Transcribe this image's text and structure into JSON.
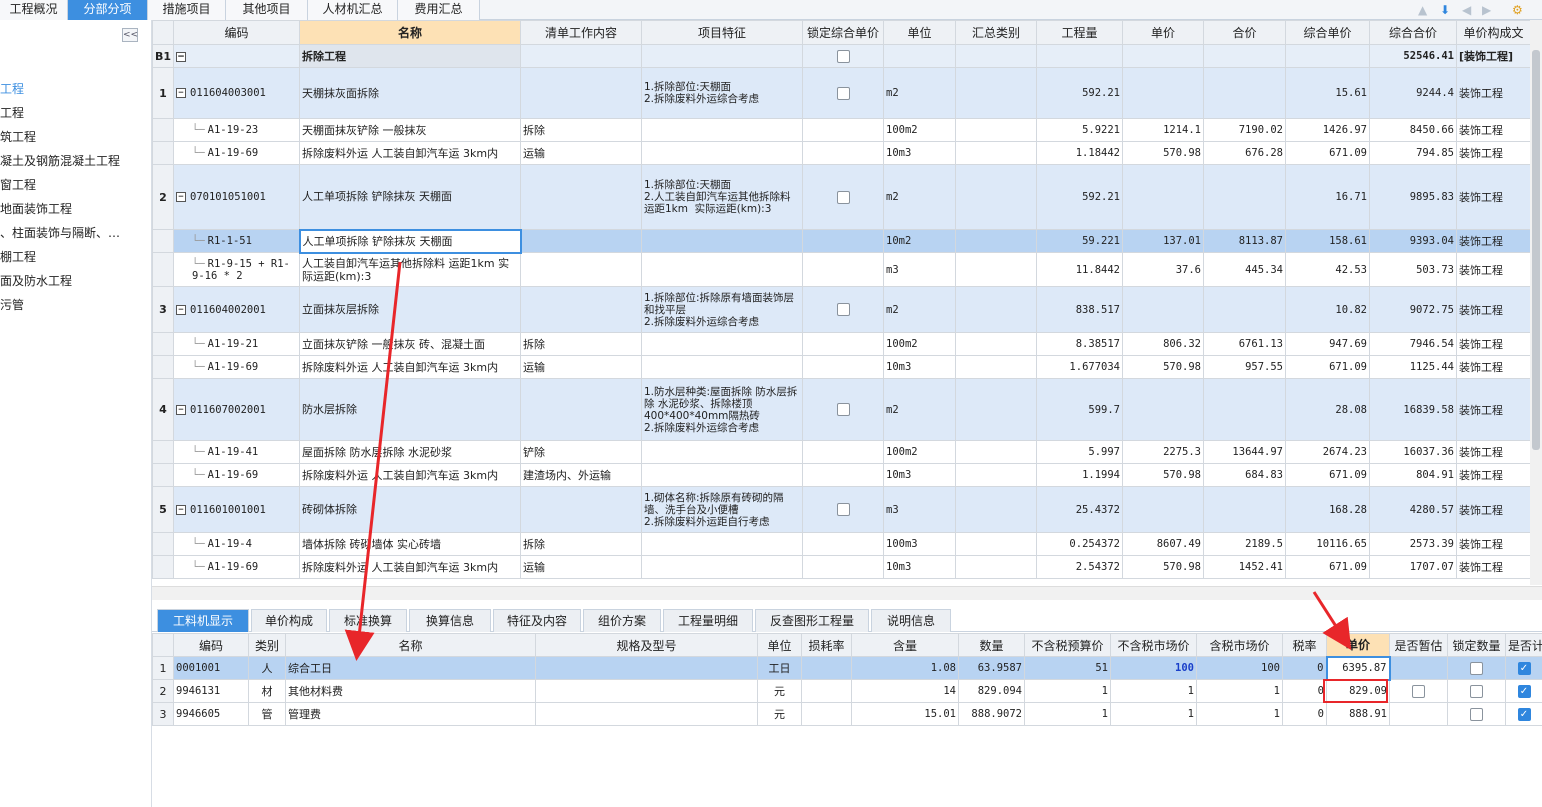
{
  "top_tabs": [
    "工程概况",
    "分部分项",
    "措施项目",
    "其他项目",
    "人材机汇总",
    "费用汇总"
  ],
  "sidebar": {
    "collapse": "<<",
    "items": [
      "工程",
      "工程",
      "筑工程",
      "凝土及钢筋混凝土工程",
      "窗工程",
      "地面装饰工程",
      "、柱面装饰与隔断、…",
      "棚工程",
      "面及防水工程",
      "污管"
    ]
  },
  "main_headers": [
    "编码",
    "名称",
    "清单工作内容",
    "项目特征",
    "锁定综合单价",
    "单位",
    "汇总类别",
    "工程量",
    "单价",
    "合价",
    "综合单价",
    "综合合价",
    "单价构成文"
  ],
  "section": {
    "num": "B1",
    "code": "",
    "name": "拆除工程",
    "total": "52546.41",
    "comp": "[装饰工程]"
  },
  "rows": [
    {
      "type": "list",
      "num": "1",
      "code": "011604003001",
      "name": "天棚抹灰面拆除",
      "work": "",
      "feat": "1.拆除部位:天棚面\n2.拆除废料外运综合考虑",
      "unit": "m2",
      "qty": "592.21",
      "price": "",
      "total": "",
      "uprice": "15.61",
      "utotal": "9244.4",
      "comp": "装饰工程"
    },
    {
      "type": "sub",
      "num": "",
      "code": "A1-19-23",
      "name": "天棚面抹灰铲除 一般抹灰",
      "work": "拆除",
      "feat": "",
      "unit": "100m2",
      "qty": "5.9221",
      "price": "1214.1",
      "total": "7190.02",
      "uprice": "1426.97",
      "utotal": "8450.66",
      "comp": "装饰工程"
    },
    {
      "type": "sub",
      "num": "",
      "code": "A1-19-69",
      "name": "拆除废料外运 人工装自卸汽车运 3km内",
      "work": "运输",
      "feat": "",
      "unit": "10m3",
      "qty": "1.18442",
      "price": "570.98",
      "total": "676.28",
      "uprice": "671.09",
      "utotal": "794.85",
      "comp": "装饰工程"
    },
    {
      "type": "list",
      "num": "2",
      "code": "070101051001",
      "name": "人工单项拆除 铲除抹灰 天棚面",
      "work": "",
      "feat": "1.拆除部位:天棚面\n2.人工装自卸汽车运其他拆除料 运距1km  实际运距(km):3",
      "unit": "m2",
      "qty": "592.21",
      "price": "",
      "total": "",
      "uprice": "16.71",
      "utotal": "9895.83",
      "comp": "装饰工程"
    },
    {
      "type": "sel",
      "num": "",
      "code": "R1-1-51",
      "name": "人工单项拆除 铲除抹灰 天棚面",
      "work": "",
      "feat": "",
      "unit": "10m2",
      "qty": "59.221",
      "price": "137.01",
      "total": "8113.87",
      "uprice": "158.61",
      "utotal": "9393.04",
      "comp": "装饰工程"
    },
    {
      "type": "sub",
      "num": "",
      "code": "R1-9-15 + R1-9-16 * 2",
      "name": "人工装自卸汽车运其他拆除料 运距1km 实际运距(km):3",
      "work": "",
      "feat": "",
      "unit": "m3",
      "qty": "11.8442",
      "price": "37.6",
      "total": "445.34",
      "uprice": "42.53",
      "utotal": "503.73",
      "comp": "装饰工程"
    },
    {
      "type": "list",
      "num": "3",
      "code": "011604002001",
      "name": "立面抹灰层拆除",
      "work": "",
      "feat": "1.拆除部位:拆除原有墙面装饰层和找平层\n2.拆除废料外运综合考虑",
      "unit": "m2",
      "qty": "838.517",
      "price": "",
      "total": "",
      "uprice": "10.82",
      "utotal": "9072.75",
      "comp": "装饰工程"
    },
    {
      "type": "sub",
      "num": "",
      "code": "A1-19-21",
      "name": "立面抹灰铲除 一般抹灰 砖、混凝土面",
      "work": "拆除",
      "feat": "",
      "unit": "100m2",
      "qty": "8.38517",
      "price": "806.32",
      "total": "6761.13",
      "uprice": "947.69",
      "utotal": "7946.54",
      "comp": "装饰工程"
    },
    {
      "type": "sub",
      "num": "",
      "code": "A1-19-69",
      "name": "拆除废料外运 人工装自卸汽车运 3km内",
      "work": "运输",
      "feat": "",
      "unit": "10m3",
      "qty": "1.677034",
      "price": "570.98",
      "total": "957.55",
      "uprice": "671.09",
      "utotal": "1125.44",
      "comp": "装饰工程"
    },
    {
      "type": "list",
      "num": "4",
      "code": "011607002001",
      "name": "防水层拆除",
      "work": "",
      "feat": "1.防水层种类:屋面拆除 防水层拆除 水泥砂浆、拆除楼顶400*400*40mm隔热砖\n2.拆除废料外运综合考虑",
      "unit": "m2",
      "qty": "599.7",
      "price": "",
      "total": "",
      "uprice": "28.08",
      "utotal": "16839.58",
      "comp": "装饰工程"
    },
    {
      "type": "sub",
      "num": "",
      "code": "A1-19-41",
      "name": "屋面拆除 防水层拆除 水泥砂浆",
      "work": "铲除",
      "feat": "",
      "unit": "100m2",
      "qty": "5.997",
      "price": "2275.3",
      "total": "13644.97",
      "uprice": "2674.23",
      "utotal": "16037.36",
      "comp": "装饰工程"
    },
    {
      "type": "sub",
      "num": "",
      "code": "A1-19-69",
      "name": "拆除废料外运 人工装自卸汽车运 3km内",
      "work": "建渣场内、外运输",
      "feat": "",
      "unit": "10m3",
      "qty": "1.1994",
      "price": "570.98",
      "total": "684.83",
      "uprice": "671.09",
      "utotal": "804.91",
      "comp": "装饰工程"
    },
    {
      "type": "list",
      "num": "5",
      "code": "011601001001",
      "name": "砖砌体拆除",
      "work": "",
      "feat": "1.砌体名称:拆除原有砖砌的隔墙、洗手台及小便槽\n2.拆除废料外运距自行考虑",
      "unit": "m3",
      "qty": "25.4372",
      "price": "",
      "total": "",
      "uprice": "168.28",
      "utotal": "4280.57",
      "comp": "装饰工程"
    },
    {
      "type": "sub",
      "num": "",
      "code": "A1-19-4",
      "name": "墙体拆除 砖砌墙体 实心砖墙",
      "work": "拆除",
      "feat": "",
      "unit": "100m3",
      "qty": "0.254372",
      "price": "8607.49",
      "total": "2189.5",
      "uprice": "10116.65",
      "utotal": "2573.39",
      "comp": "装饰工程"
    },
    {
      "type": "sub",
      "num": "",
      "code": "A1-19-69",
      "name": "拆除废料外运 人工装自卸汽车运 3km内",
      "work": "运输",
      "feat": "",
      "unit": "10m3",
      "qty": "2.54372",
      "price": "570.98",
      "total": "1452.41",
      "uprice": "671.09",
      "utotal": "1707.07",
      "comp": "装饰工程"
    }
  ],
  "bottom_tabs": [
    "工料机显示",
    "单价构成",
    "标准换算",
    "换算信息",
    "特征及内容",
    "组价方案",
    "工程量明细",
    "反查图形工程量",
    "说明信息"
  ],
  "bottom_headers": [
    "编码",
    "类别",
    "名称",
    "规格及型号",
    "单位",
    "损耗率",
    "含量",
    "数量",
    "不含税预算价",
    "不含税市场价",
    "含税市场价",
    "税率",
    "单价",
    "是否暂估",
    "锁定数量",
    "是否计"
  ],
  "bottom_rows": [
    {
      "num": "1",
      "code": "0001001",
      "cat": "人",
      "name": "综合工日",
      "spec": "",
      "unit": "工日",
      "loss": "",
      "content": "1.08",
      "qty": "63.9587",
      "budget": "51",
      "market": "100",
      "taxmarket": "100",
      "tax": "0",
      "price": "6395.87"
    },
    {
      "num": "2",
      "code": "9946131",
      "cat": "材",
      "name": "其他材料费",
      "spec": "",
      "unit": "元",
      "loss": "",
      "content": "14",
      "qty": "829.094",
      "budget": "1",
      "market": "1",
      "taxmarket": "1",
      "tax": "0",
      "price": "829.09"
    },
    {
      "num": "3",
      "code": "9946605",
      "cat": "管",
      "name": "管理费",
      "spec": "",
      "unit": "元",
      "loss": "",
      "content": "15.01",
      "qty": "888.9072",
      "budget": "1",
      "market": "1",
      "taxmarket": "1",
      "tax": "0",
      "price": "888.91"
    }
  ],
  "colors": {
    "accent": "#3d8fe0",
    "annotation": "#e8262a",
    "selected_row": "#b8d3f2"
  }
}
